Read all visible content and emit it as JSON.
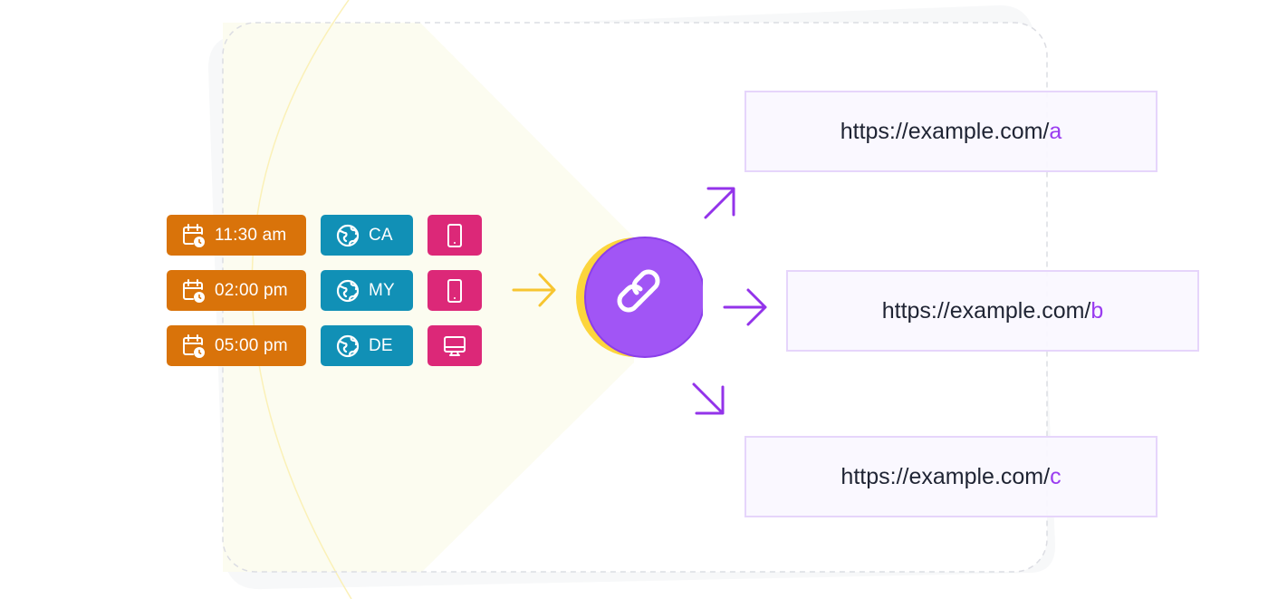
{
  "diagram": {
    "title": "",
    "colors": {
      "time_tag": "#d9730a",
      "geo_tag": "#1190b6",
      "device_tag": "#dc2878",
      "hub": "#a155f5",
      "hub_shadow": "#fcd53c",
      "input_arrow": "#f7c530",
      "output_arrow": "#9333ea",
      "url_suffix": "#9a3cf0",
      "url_border": "#e6d5fb",
      "beam": "#fcfcf0"
    },
    "rules": [
      {
        "time": "11:30 am",
        "time_icon": "calendar-clock-icon",
        "geo": "CA",
        "geo_icon": "globe-icon",
        "device_icon": "tablet-icon"
      },
      {
        "time": "02:00 pm",
        "time_icon": "calendar-clock-icon",
        "geo": "MY",
        "geo_icon": "globe-icon",
        "device_icon": "tablet-icon"
      },
      {
        "time": "05:00 pm",
        "time_icon": "calendar-clock-icon",
        "geo": "DE",
        "geo_icon": "globe-icon",
        "device_icon": "desktop-icon"
      }
    ],
    "hub": {
      "icon": "link-icon"
    },
    "input_arrow": {
      "icon": "arrow-right-icon"
    },
    "output_arrows": [
      {
        "icon": "arrow-up-right-icon"
      },
      {
        "icon": "arrow-right-icon"
      },
      {
        "icon": "arrow-down-right-icon"
      }
    ],
    "destinations": [
      {
        "base": "https://example.com/",
        "suffix": "a"
      },
      {
        "base": "https://example.com/",
        "suffix": "b"
      },
      {
        "base": "https://example.com/",
        "suffix": "c"
      }
    ]
  }
}
